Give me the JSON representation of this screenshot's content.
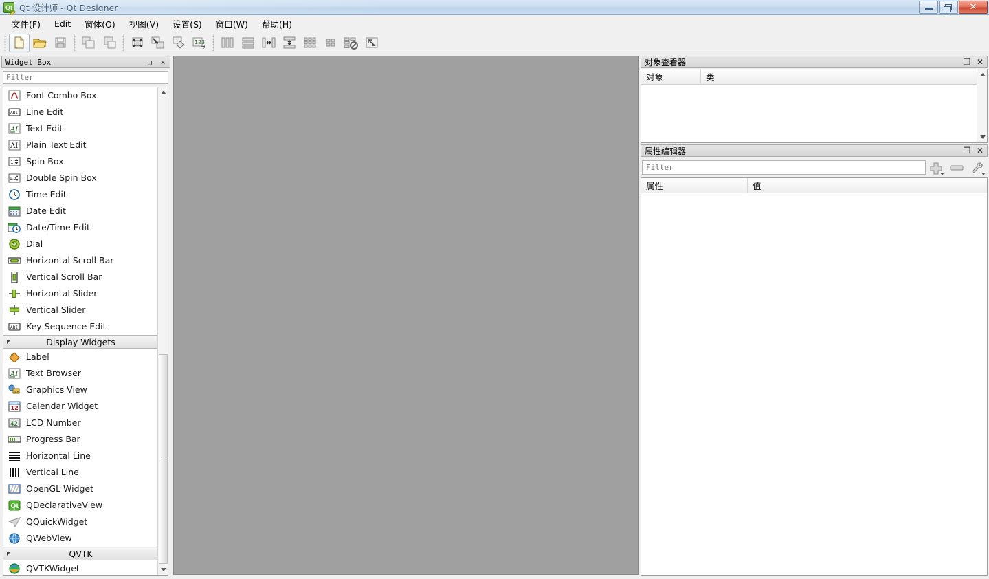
{
  "window": {
    "title": "Qt 设计师 - Qt Designer",
    "app_icon": "qt-logo-icon",
    "minimize_label": "",
    "maximize_label": "",
    "close_label": "✕"
  },
  "menubar": {
    "items": [
      {
        "label": "文件(F)",
        "name": "menu-file"
      },
      {
        "label": "Edit",
        "name": "menu-edit"
      },
      {
        "label": "窗体(O)",
        "name": "menu-form"
      },
      {
        "label": "视图(V)",
        "name": "menu-view"
      },
      {
        "label": "设置(S)",
        "name": "menu-settings"
      },
      {
        "label": "窗口(W)",
        "name": "menu-window"
      },
      {
        "label": "帮助(H)",
        "name": "menu-help"
      }
    ]
  },
  "toolbar": {
    "groups": [
      [
        "new-form-icon",
        "open-form-icon",
        "save-form-icon"
      ],
      [
        "undo-icon",
        "redo-icon"
      ],
      [
        "edit-widgets-icon",
        "edit-signals-slots-icon",
        "edit-buddies-icon",
        "edit-tab-order-icon"
      ],
      [
        "layout-horizontally-icon",
        "layout-vertically-icon",
        "layout-in-splitter-horizontal-icon",
        "layout-in-splitter-vertical-icon",
        "layout-in-grid-icon",
        "layout-in-form-icon",
        "break-layout-icon",
        "adjust-size-icon"
      ]
    ]
  },
  "widget_box": {
    "title": "Widget Box",
    "float_label": "❐",
    "close_label": "✕",
    "filter_placeholder": "Filter",
    "filter_value": "",
    "items": [
      {
        "type": "widget",
        "label": "Font Combo Box",
        "icon": "font-combo-box-icon"
      },
      {
        "type": "widget",
        "label": "Line Edit",
        "icon": "line-edit-icon"
      },
      {
        "type": "widget",
        "label": "Text Edit",
        "icon": "text-edit-icon"
      },
      {
        "type": "widget",
        "label": "Plain Text Edit",
        "icon": "plain-text-edit-icon"
      },
      {
        "type": "widget",
        "label": "Spin Box",
        "icon": "spin-box-icon"
      },
      {
        "type": "widget",
        "label": "Double Spin Box",
        "icon": "double-spin-box-icon"
      },
      {
        "type": "widget",
        "label": "Time Edit",
        "icon": "time-edit-icon"
      },
      {
        "type": "widget",
        "label": "Date Edit",
        "icon": "date-edit-icon"
      },
      {
        "type": "widget",
        "label": "Date/Time Edit",
        "icon": "date-time-edit-icon"
      },
      {
        "type": "widget",
        "label": "Dial",
        "icon": "dial-icon"
      },
      {
        "type": "widget",
        "label": "Horizontal Scroll Bar",
        "icon": "horizontal-scroll-bar-icon"
      },
      {
        "type": "widget",
        "label": "Vertical Scroll Bar",
        "icon": "vertical-scroll-bar-icon"
      },
      {
        "type": "widget",
        "label": "Horizontal Slider",
        "icon": "horizontal-slider-icon"
      },
      {
        "type": "widget",
        "label": "Vertical Slider",
        "icon": "vertical-slider-icon"
      },
      {
        "type": "widget",
        "label": "Key Sequence Edit",
        "icon": "key-sequence-edit-icon"
      },
      {
        "type": "category",
        "label": "Display Widgets",
        "icon": "collapse-triangle-icon"
      },
      {
        "type": "widget",
        "label": "Label",
        "icon": "label-icon"
      },
      {
        "type": "widget",
        "label": "Text Browser",
        "icon": "text-browser-icon"
      },
      {
        "type": "widget",
        "label": "Graphics View",
        "icon": "graphics-view-icon"
      },
      {
        "type": "widget",
        "label": "Calendar Widget",
        "icon": "calendar-widget-icon"
      },
      {
        "type": "widget",
        "label": "LCD Number",
        "icon": "lcd-number-icon"
      },
      {
        "type": "widget",
        "label": "Progress Bar",
        "icon": "progress-bar-icon"
      },
      {
        "type": "widget",
        "label": "Horizontal Line",
        "icon": "horizontal-line-icon"
      },
      {
        "type": "widget",
        "label": "Vertical Line",
        "icon": "vertical-line-icon"
      },
      {
        "type": "widget",
        "label": "OpenGL Widget",
        "icon": "opengl-widget-icon"
      },
      {
        "type": "widget",
        "label": "QDeclarativeView",
        "icon": "qdeclarativeview-icon"
      },
      {
        "type": "widget",
        "label": "QQuickWidget",
        "icon": "qquickwidget-icon"
      },
      {
        "type": "widget",
        "label": "QWebView",
        "icon": "qwebview-icon"
      },
      {
        "type": "category",
        "label": "QVTK",
        "icon": "collapse-triangle-icon"
      },
      {
        "type": "widget",
        "label": "QVTKWidget",
        "icon": "qvtkwidget-icon"
      }
    ]
  },
  "object_inspector": {
    "title": "对象查看器",
    "float_label": "❐",
    "close_label": "✕",
    "columns": [
      "对象",
      "类"
    ],
    "rows": []
  },
  "property_editor": {
    "title": "属性编辑器",
    "float_label": "❐",
    "close_label": "✕",
    "filter_placeholder": "Filter",
    "filter_value": "",
    "add_label": "add-property-icon",
    "remove_label": "remove-property-icon",
    "configure_label": "configure-icon",
    "columns": [
      "属性",
      "值"
    ],
    "rows": []
  },
  "canvas": {
    "name": "form-canvas",
    "background": "#a0a0a0"
  },
  "colors": {
    "titlebar_start": "#d7e6f5",
    "titlebar_end": "#cde0f2",
    "chrome": "#f0f0f0",
    "canvas": "#a0a0a0",
    "panel_border": "#9e9e9e",
    "close_button": "#c8452f"
  }
}
